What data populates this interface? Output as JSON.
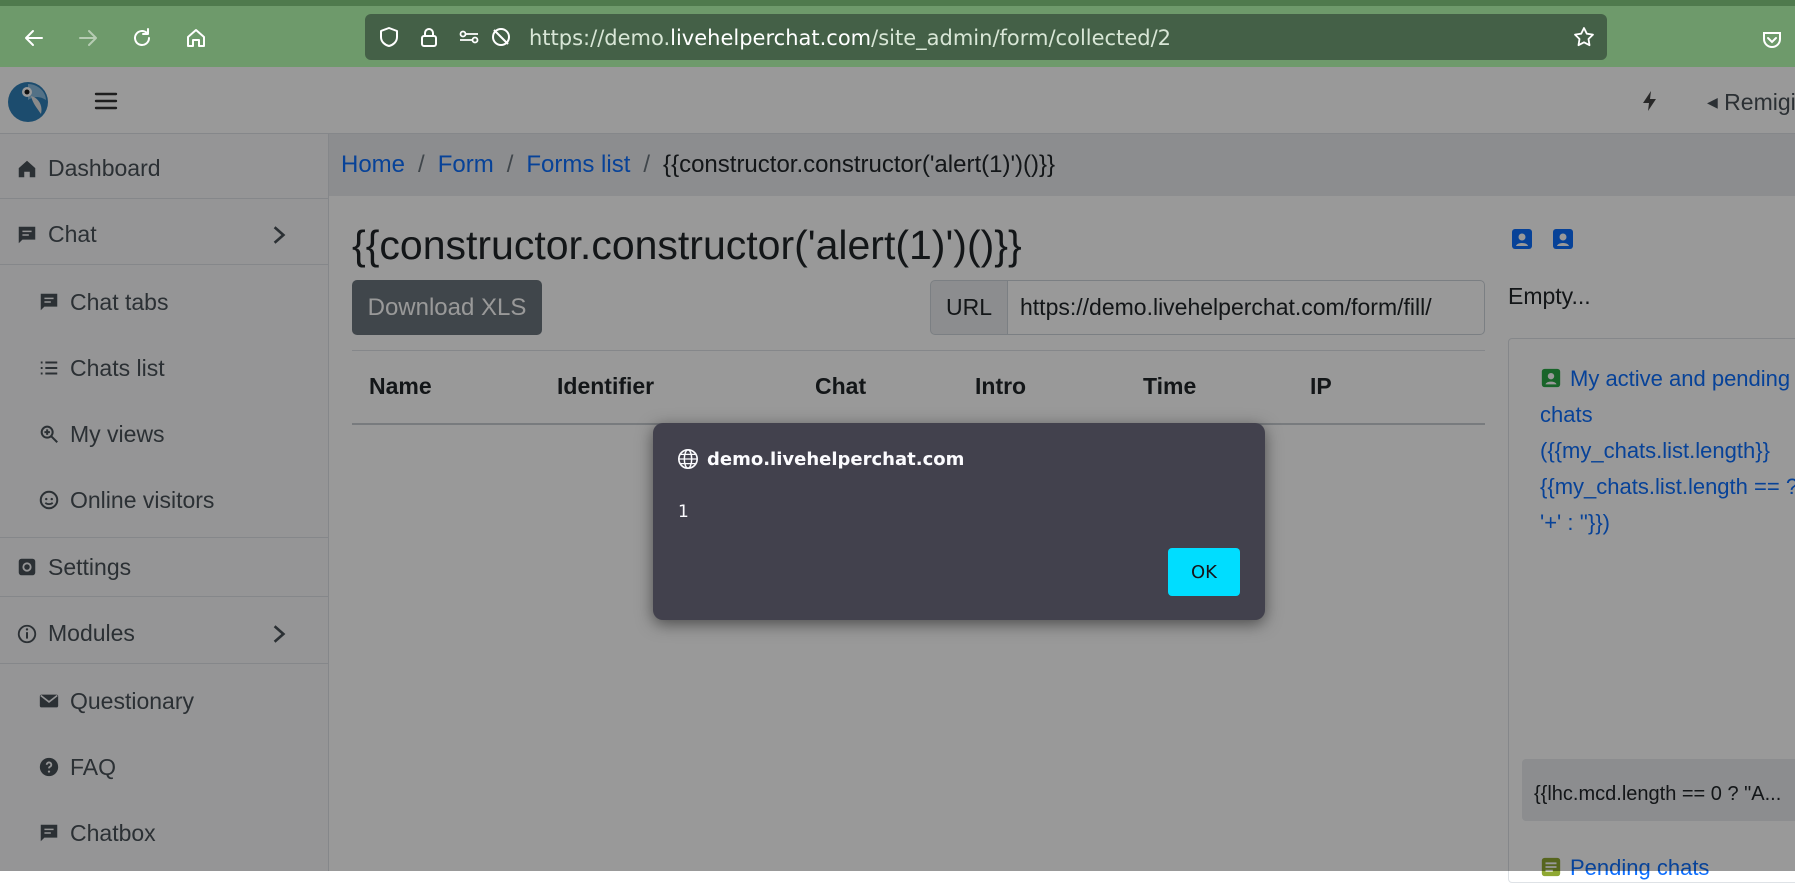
{
  "browser": {
    "url_prefix": "https://demo.",
    "url_domain": "livehelperchat.com",
    "url_path": "/site_admin/form/collected/2"
  },
  "header": {
    "user_name": "Remigi"
  },
  "sidebar": {
    "items": [
      {
        "label": "Dashboard"
      },
      {
        "label": "Chat"
      },
      {
        "label": "Chat tabs"
      },
      {
        "label": "Chats list"
      },
      {
        "label": "My views"
      },
      {
        "label": "Online visitors"
      },
      {
        "label": "Settings"
      },
      {
        "label": "Modules"
      },
      {
        "label": "Questionary"
      },
      {
        "label": "FAQ"
      },
      {
        "label": "Chatbox"
      }
    ]
  },
  "breadcrumb": {
    "items": [
      "Home",
      "Form",
      "Forms list"
    ],
    "current": "{{constructor.constructor('alert(1)')()}}",
    "separator": "/"
  },
  "main": {
    "title": "{{constructor.constructor('alert(1)')()}}",
    "download_label": "Download XLS",
    "url_label": "URL",
    "url_value": "https://demo.livehelperchat.com/form/fill/",
    "columns": [
      "Name",
      "Identifier",
      "Chat",
      "Intro",
      "Time",
      "IP"
    ]
  },
  "right_panel": {
    "empty_text": "Empty...",
    "card_title": "My active and pending chats ({{my_chats.list.length}}{{my_chats.list.length == ? '+' : ''}})",
    "select_value": "{{lhc.mcd.length == 0 ? \"A...",
    "pending_label": "Pending chats"
  },
  "dialog": {
    "origin": "demo.livehelperchat.com",
    "message": "1",
    "ok_label": "OK"
  },
  "colors": {
    "browser_chrome": "#6e9a6b",
    "urlbar": "#446047",
    "link": "#0d6efd",
    "dialog_bg": "#42414d",
    "ok_button": "#00ddff"
  }
}
